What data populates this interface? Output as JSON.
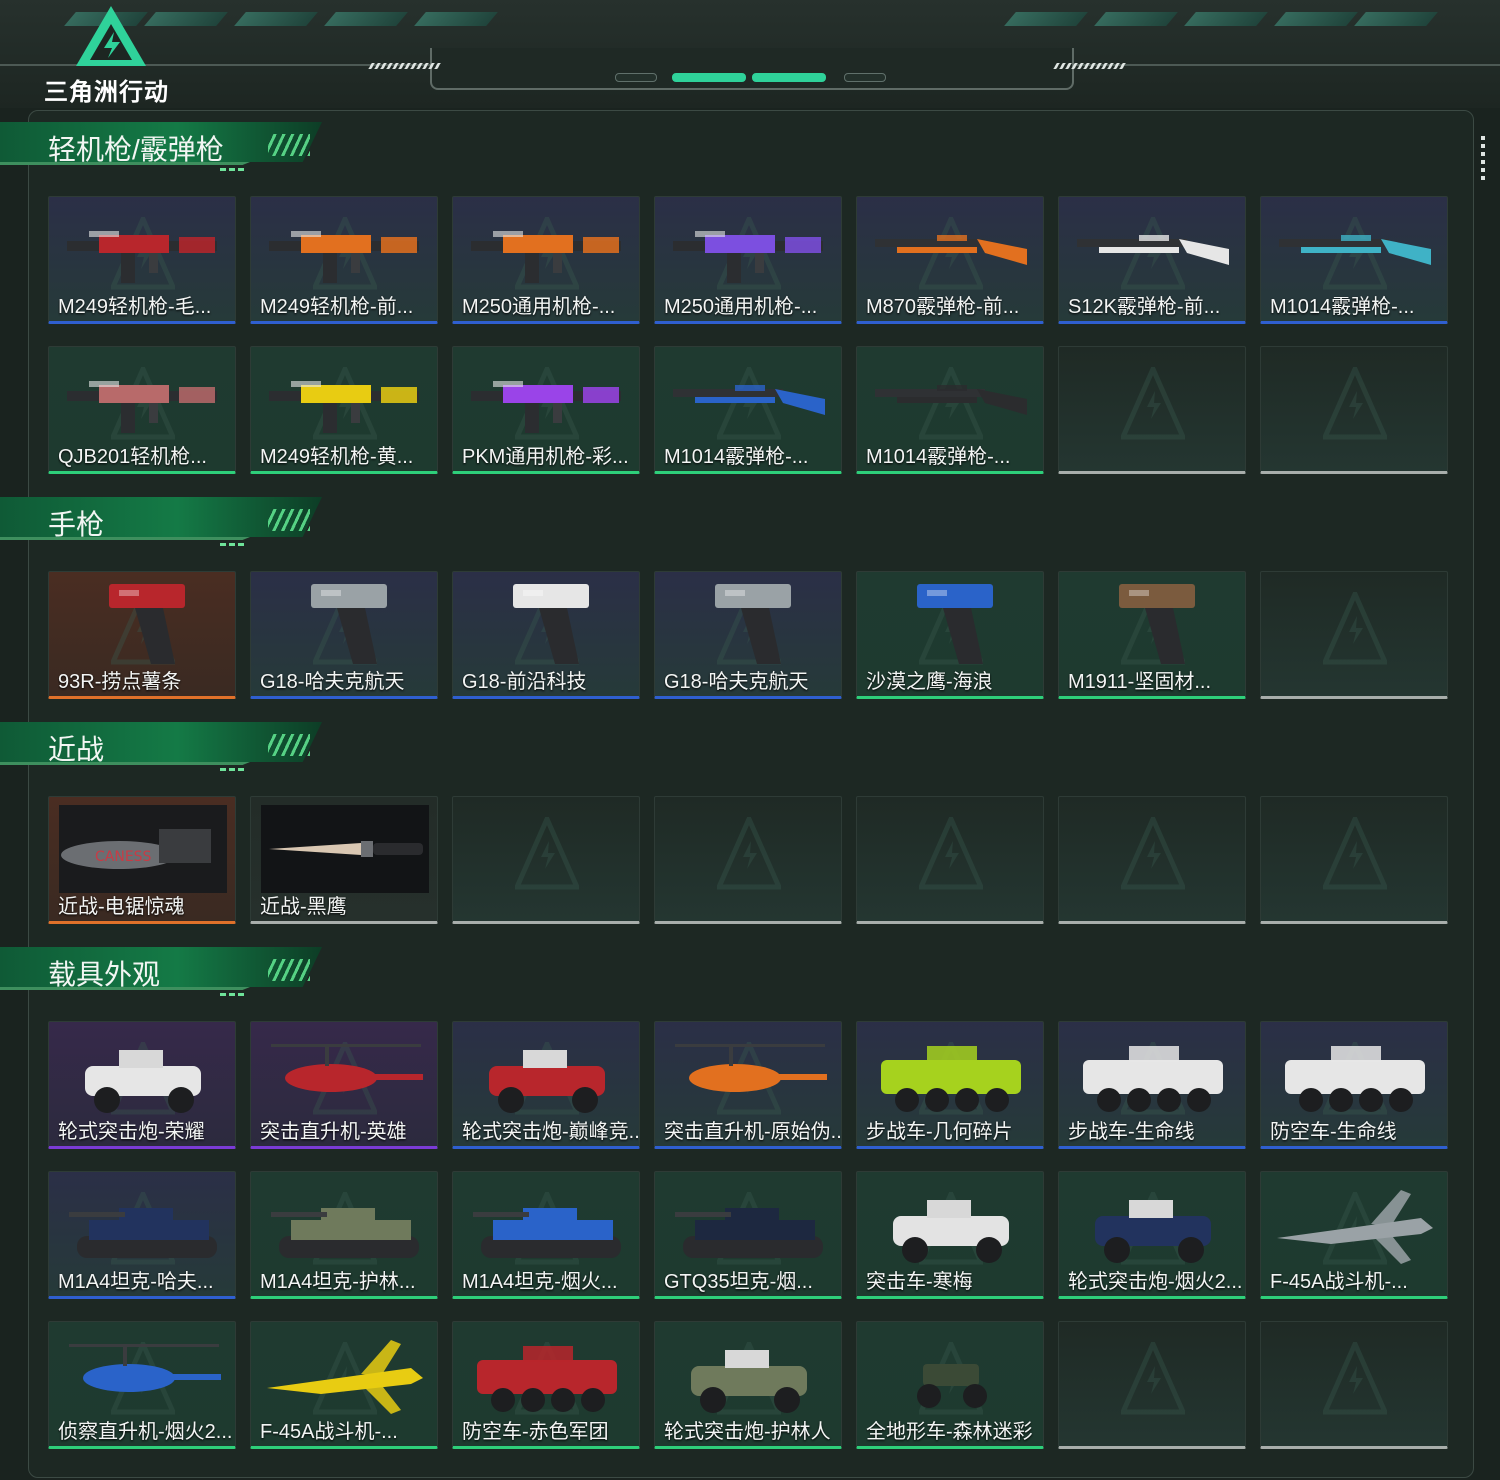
{
  "brand": "三角洲行动",
  "sections": [
    {
      "title": "轻机枪/霰弹枪",
      "items": [
        {
          "label": "M249轻机枪-毛...",
          "quality": "blue",
          "icon": "lmg-red"
        },
        {
          "label": "M249轻机枪-前...",
          "quality": "blue",
          "icon": "lmg-orange"
        },
        {
          "label": "M250通用机枪-...",
          "quality": "blue",
          "icon": "gpmg-orange"
        },
        {
          "label": "M250通用机枪-...",
          "quality": "blue",
          "icon": "gpmg-purple"
        },
        {
          "label": "M870霰弹枪-前...",
          "quality": "blue",
          "icon": "shotgun-orange"
        },
        {
          "label": "S12K霰弹枪-前...",
          "quality": "blue",
          "icon": "shotgun-white"
        },
        {
          "label": "M1014霰弹枪-...",
          "quality": "blue",
          "icon": "shotgun-cyan"
        },
        {
          "label": "QJB201轻机枪...",
          "quality": "green",
          "icon": "lmg-pink"
        },
        {
          "label": "M249轻机枪-黄...",
          "quality": "green",
          "icon": "lmg-yellow"
        },
        {
          "label": "PKM通用机枪-彩...",
          "quality": "green",
          "icon": "gpmg-violet"
        },
        {
          "label": "M1014霰弹枪-...",
          "quality": "green",
          "icon": "shotgun-blue"
        },
        {
          "label": "M1014霰弹枪-...",
          "quality": "green",
          "icon": "shotgun-black"
        },
        {
          "label": "",
          "quality": "empty"
        },
        {
          "label": "",
          "quality": "empty"
        }
      ]
    },
    {
      "title": "手枪",
      "items": [
        {
          "label": "93R-捞点薯条",
          "quality": "orange",
          "icon": "pistol-red"
        },
        {
          "label": "G18-哈夫克航天",
          "quality": "blue",
          "icon": "pistol-gray"
        },
        {
          "label": "G18-前沿科技",
          "quality": "blue",
          "icon": "pistol-white"
        },
        {
          "label": "G18-哈夫克航天",
          "quality": "blue",
          "icon": "pistol-gray"
        },
        {
          "label": "沙漠之鹰-海浪",
          "quality": "green",
          "icon": "pistol-blue"
        },
        {
          "label": "M1911-坚固材...",
          "quality": "green",
          "icon": "pistol-brown"
        },
        {
          "label": "",
          "quality": "empty"
        }
      ]
    },
    {
      "title": "近战",
      "items": [
        {
          "label": "近战-电锯惊魂",
          "quality": "orange",
          "icon": "chainsaw"
        },
        {
          "label": "近战-黑鹰",
          "quality": "gray",
          "icon": "knife"
        },
        {
          "label": "",
          "quality": "empty"
        },
        {
          "label": "",
          "quality": "empty"
        },
        {
          "label": "",
          "quality": "empty"
        },
        {
          "label": "",
          "quality": "empty"
        },
        {
          "label": "",
          "quality": "empty"
        }
      ]
    },
    {
      "title": "载具外观",
      "items": [
        {
          "label": "轮式突击炮-荣耀",
          "quality": "purple",
          "icon": "buggy-white"
        },
        {
          "label": "突击直升机-英雄",
          "quality": "purple",
          "icon": "heli-red"
        },
        {
          "label": "轮式突击炮-巅峰竞...",
          "quality": "blue",
          "icon": "buggy-red"
        },
        {
          "label": "突击直升机-原始伪...",
          "quality": "blue",
          "icon": "heli-orange"
        },
        {
          "label": "步战车-几何碎片",
          "quality": "blue",
          "icon": "ifv-green"
        },
        {
          "label": "步战车-生命线",
          "quality": "blue",
          "icon": "ifv-white"
        },
        {
          "label": "防空车-生命线",
          "quality": "blue",
          "icon": "ifv-white"
        },
        {
          "label": "M1A4坦克-哈夫...",
          "quality": "blue",
          "icon": "tank-navy"
        },
        {
          "label": "M1A4坦克-护林...",
          "quality": "green",
          "icon": "tank-camo"
        },
        {
          "label": "M1A4坦克-烟火...",
          "quality": "green",
          "icon": "tank-blue"
        },
        {
          "label": "GTQ35坦克-烟...",
          "quality": "green",
          "icon": "tank-dark"
        },
        {
          "label": "突击车-寒梅",
          "quality": "green",
          "icon": "buggy-snow"
        },
        {
          "label": "轮式突击炮-烟火2...",
          "quality": "green",
          "icon": "buggy-navy"
        },
        {
          "label": "F-45A战斗机-...",
          "quality": "green",
          "icon": "jet-gray"
        },
        {
          "label": "侦察直升机-烟火2...",
          "quality": "green",
          "icon": "heli-blue"
        },
        {
          "label": "F-45A战斗机-...",
          "quality": "green",
          "icon": "jet-yellow"
        },
        {
          "label": "防空车-赤色军团",
          "quality": "green",
          "icon": "ifv-red"
        },
        {
          "label": "轮式突击炮-护林人",
          "quality": "green",
          "icon": "buggy-camo"
        },
        {
          "label": "全地形车-森林迷彩",
          "quality": "green",
          "icon": "atv"
        },
        {
          "label": "",
          "quality": "empty"
        },
        {
          "label": "",
          "quality": "empty"
        }
      ]
    }
  ],
  "colors": {
    "blue": "#2f5fd0",
    "purple": "#7b3bd6",
    "green": "#2ecf7a",
    "orange": "#e0712a",
    "gray": "#a8aeab",
    "accent": "#2fd29a"
  }
}
